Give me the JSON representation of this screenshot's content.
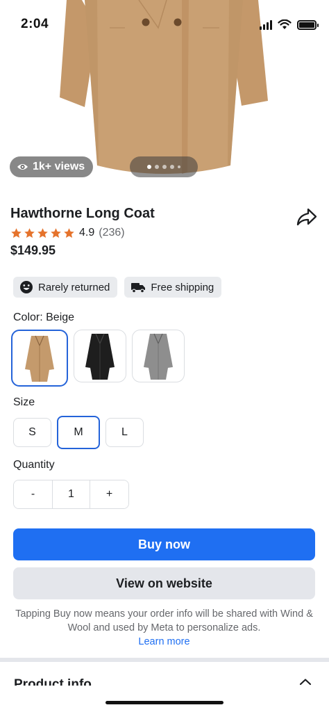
{
  "status_bar": {
    "time": "2:04"
  },
  "hero": {
    "views_label": "1k+ views",
    "image_count": 5,
    "active_image": 1
  },
  "product": {
    "title": "Hawthorne Long Coat",
    "rating": "4.9",
    "rating_count": "(236)",
    "stars": 5,
    "price": "$149.95"
  },
  "badges": [
    {
      "label": "Rarely returned",
      "icon": "smile-icon"
    },
    {
      "label": "Free shipping",
      "icon": "truck-icon"
    }
  ],
  "color": {
    "label": "Color: Beige",
    "options": [
      {
        "name": "Beige",
        "hex": "#c49a6c",
        "selected": true
      },
      {
        "name": "Black",
        "hex": "#1e1e1e",
        "selected": false
      },
      {
        "name": "Gray",
        "hex": "#8e8e8e",
        "selected": false
      }
    ]
  },
  "size": {
    "label": "Size",
    "options": [
      "S",
      "M",
      "L"
    ],
    "selected": "M"
  },
  "quantity": {
    "label": "Quantity",
    "minus": "-",
    "value": "1",
    "plus": "+"
  },
  "actions": {
    "buy_now": "Buy now",
    "view_on_website": "View on website"
  },
  "disclaimer": {
    "text": "Tapping Buy now means your order info will be shared with Wind & Wool and used by Meta to personalize ads.",
    "link": "Learn more"
  },
  "section": {
    "title": "Product info"
  },
  "colors": {
    "accent": "#1f6ff2",
    "star": "#e5732c",
    "selected_border": "#2463d9"
  }
}
